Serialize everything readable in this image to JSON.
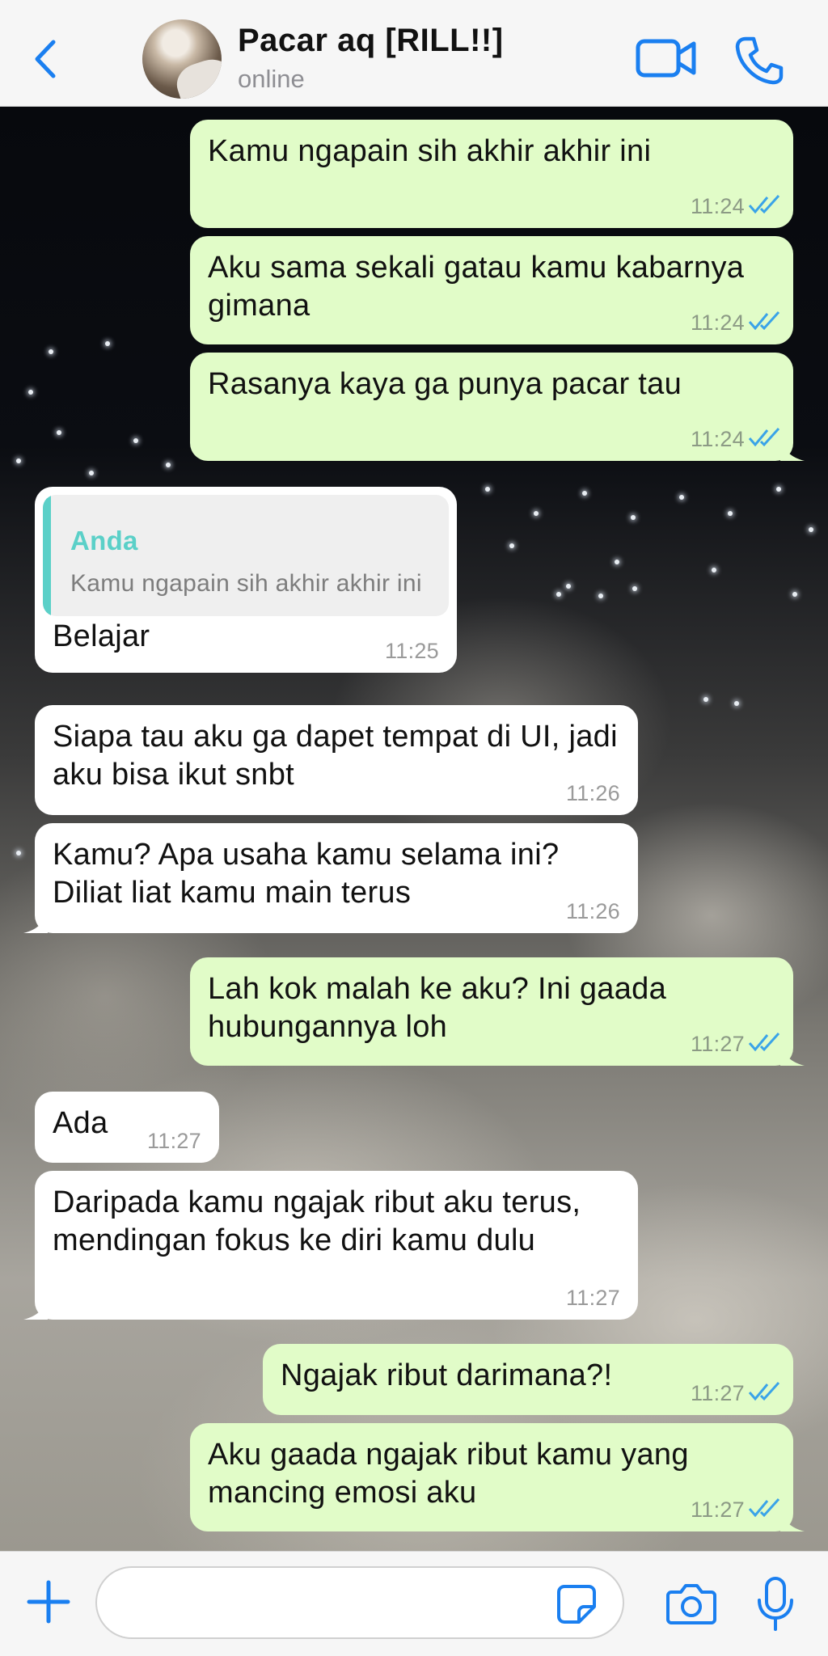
{
  "header": {
    "back_icon": "chevron-left-icon",
    "contact_name": "Pacar aq [RILL!!]",
    "status": "online",
    "video_icon": "video-camera-icon",
    "call_icon": "phone-icon"
  },
  "messages": [
    {
      "direction": "out",
      "text": "Kamu ngapain sih akhir akhir ini",
      "time": "11:24",
      "status": "read"
    },
    {
      "direction": "out",
      "text": "Aku sama sekali gatau kamu kabarnya gimana",
      "time": "11:24",
      "status": "read"
    },
    {
      "direction": "out",
      "text": "Rasanya kaya ga punya pacar tau",
      "time": "11:24",
      "status": "read"
    },
    {
      "direction": "in",
      "reply_to": {
        "author": "Anda",
        "text": "Kamu ngapain sih akhir akhir ini"
      },
      "text": "Belajar",
      "time": "11:25"
    },
    {
      "direction": "in",
      "text": "Siapa tau aku ga dapet tempat di UI, jadi aku bisa ikut snbt",
      "time": "11:26"
    },
    {
      "direction": "in",
      "text": "Kamu? Apa usaha kamu selama ini? Diliat liat kamu main terus",
      "time": "11:26"
    },
    {
      "direction": "out",
      "text": "Lah kok malah ke aku? Ini gaada hubungannya loh",
      "time": "11:27",
      "status": "read"
    },
    {
      "direction": "in",
      "text": "Ada",
      "time": "11:27"
    },
    {
      "direction": "in",
      "text": "Daripada kamu ngajak ribut aku terus, mendingan fokus ke diri kamu dulu",
      "time": "11:27"
    },
    {
      "direction": "out",
      "text": "Ngajak ribut darimana?!",
      "time": "11:27",
      "status": "read"
    },
    {
      "direction": "out",
      "text": "Aku gaada ngajak ribut kamu yang mancing emosi aku",
      "time": "11:27",
      "status": "read"
    }
  ],
  "composer": {
    "placeholder": "",
    "attach_icon": "plus-icon",
    "sticker_icon": "sticker-icon",
    "camera_icon": "camera-icon",
    "mic_icon": "microphone-icon"
  },
  "colors": {
    "accent": "#1a7ff0",
    "outgoing_bubble": "#e1fcc8",
    "incoming_bubble": "#ffffff",
    "read_ticks": "#3aa3e8",
    "reply_accent": "#5bd0c8"
  }
}
